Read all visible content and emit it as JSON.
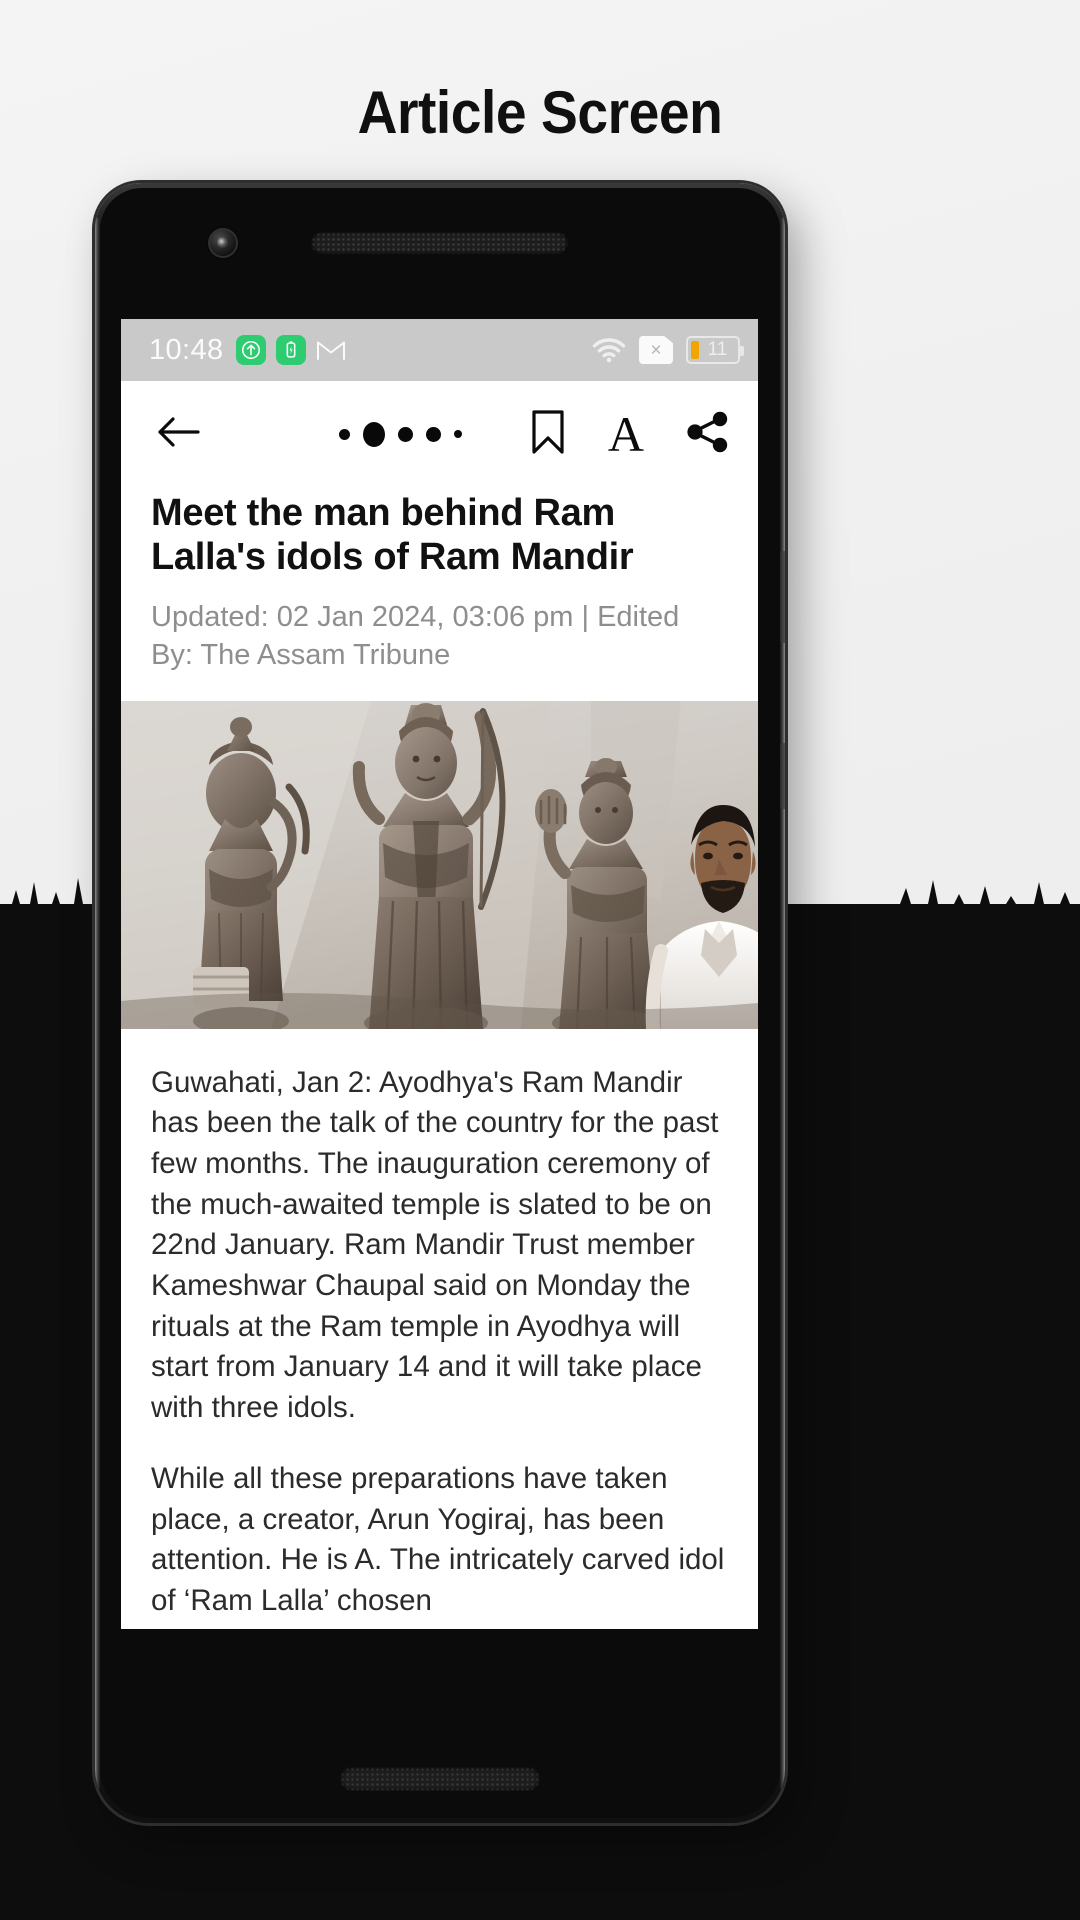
{
  "page": {
    "title": "Article Screen"
  },
  "status_bar": {
    "time": "10:48",
    "icons": [
      {
        "name": "upload-arrow-icon",
        "color": "#2ecc71"
      },
      {
        "name": "battery-saver-icon",
        "color": "#2ecc71"
      },
      {
        "name": "gmail-icon",
        "color": "#ffffff"
      }
    ],
    "right_icons": [
      {
        "name": "wifi-icon"
      },
      {
        "name": "no-sim-icon",
        "label": "×"
      }
    ],
    "battery": {
      "level_label": "11",
      "fill_color": "#f0a500"
    }
  },
  "toolbar": {
    "back_icon": "arrow-left-icon",
    "progress_dots": 5,
    "bookmark_icon": "bookmark-icon",
    "font_size_label": "A",
    "share_icon": "share-icon"
  },
  "article": {
    "headline": "Meet the man behind Ram Lalla's idols of Ram Mandir",
    "meta": "Updated: 02 Jan 2024, 03:06 pm | Edited By: The Assam Tribune",
    "hero_image_alt": "Three carved stone idols of Ram Lalla with sculptor standing beside them",
    "paragraphs": [
      "Guwahati, Jan 2: Ayodhya's Ram Mandir has been the talk of the country for the past few months. The inauguration ceremony of the much-awaited temple is slated to be on 22nd January. Ram Mandir Trust member Kameshwar Chaupal said on Monday the rituals at the Ram temple in Ayodhya will start from January 14 and it will take place with three idols.",
      "While all these preparations have taken place, a creator, Arun Yogiraj, has been attention. He is A. The intricately carved idol of ‘Ram Lalla’ chosen"
    ]
  },
  "colors": {
    "status_bar_bg": "#c9c9c9",
    "screen_bg": "#ffffff",
    "meta_text": "#8e8e8e",
    "body_text": "#2b2b2b",
    "page_bg": "#f1f1f1",
    "silhouette": "#0d0d0d"
  }
}
